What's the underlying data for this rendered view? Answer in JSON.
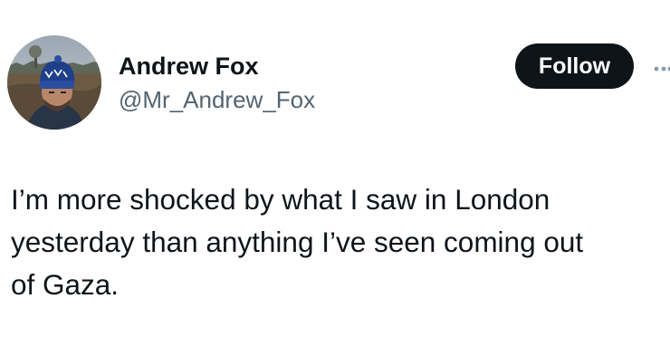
{
  "author": {
    "display_name": "Andrew Fox",
    "handle": "@Mr_Andrew_Fox",
    "avatar_icon": "profile-photo"
  },
  "actions": {
    "follow_label": "Follow",
    "more_icon": "more-horizontal-icon"
  },
  "tweet": {
    "text": "I’m more shocked by what I saw in London\nyesterday than anything I’ve seen coming out\nof Gaza."
  },
  "colors": {
    "text_primary": "#0f1419",
    "text_secondary": "#536471",
    "follow_button_bg": "#0f1419",
    "follow_button_text": "#ffffff"
  }
}
